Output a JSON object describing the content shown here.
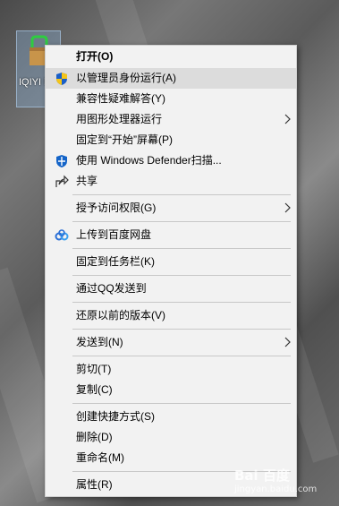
{
  "desktop": {
    "icon_label": "IQIYI home"
  },
  "menu": {
    "items": [
      {
        "label": "打开(O)"
      },
      {
        "label": "以管理员身份运行(A)"
      },
      {
        "label": "兼容性疑难解答(Y)"
      },
      {
        "label": "用图形处理器运行"
      },
      {
        "label": "固定到“开始”屏幕(P)"
      },
      {
        "label": "使用 Windows Defender扫描..."
      },
      {
        "label": "共享"
      },
      {
        "label": "授予访问权限(G)"
      },
      {
        "label": "上传到百度网盘"
      },
      {
        "label": "固定到任务栏(K)"
      },
      {
        "label": "通过QQ发送到"
      },
      {
        "label": "还原以前的版本(V)"
      },
      {
        "label": "发送到(N)"
      },
      {
        "label": "剪切(T)"
      },
      {
        "label": "复制(C)"
      },
      {
        "label": "创建快捷方式(S)"
      },
      {
        "label": "删除(D)"
      },
      {
        "label": "重命名(M)"
      },
      {
        "label": "属性(R)"
      }
    ]
  },
  "watermark": {
    "text": "Bai 百度",
    "sub": "jingyan.baidu.com"
  },
  "colors": {
    "menu_bg": "#f2f2f2",
    "hover_bg": "#dcdcdc",
    "defender_blue": "#1464c8",
    "baidu_blue": "#2a6fd6"
  }
}
